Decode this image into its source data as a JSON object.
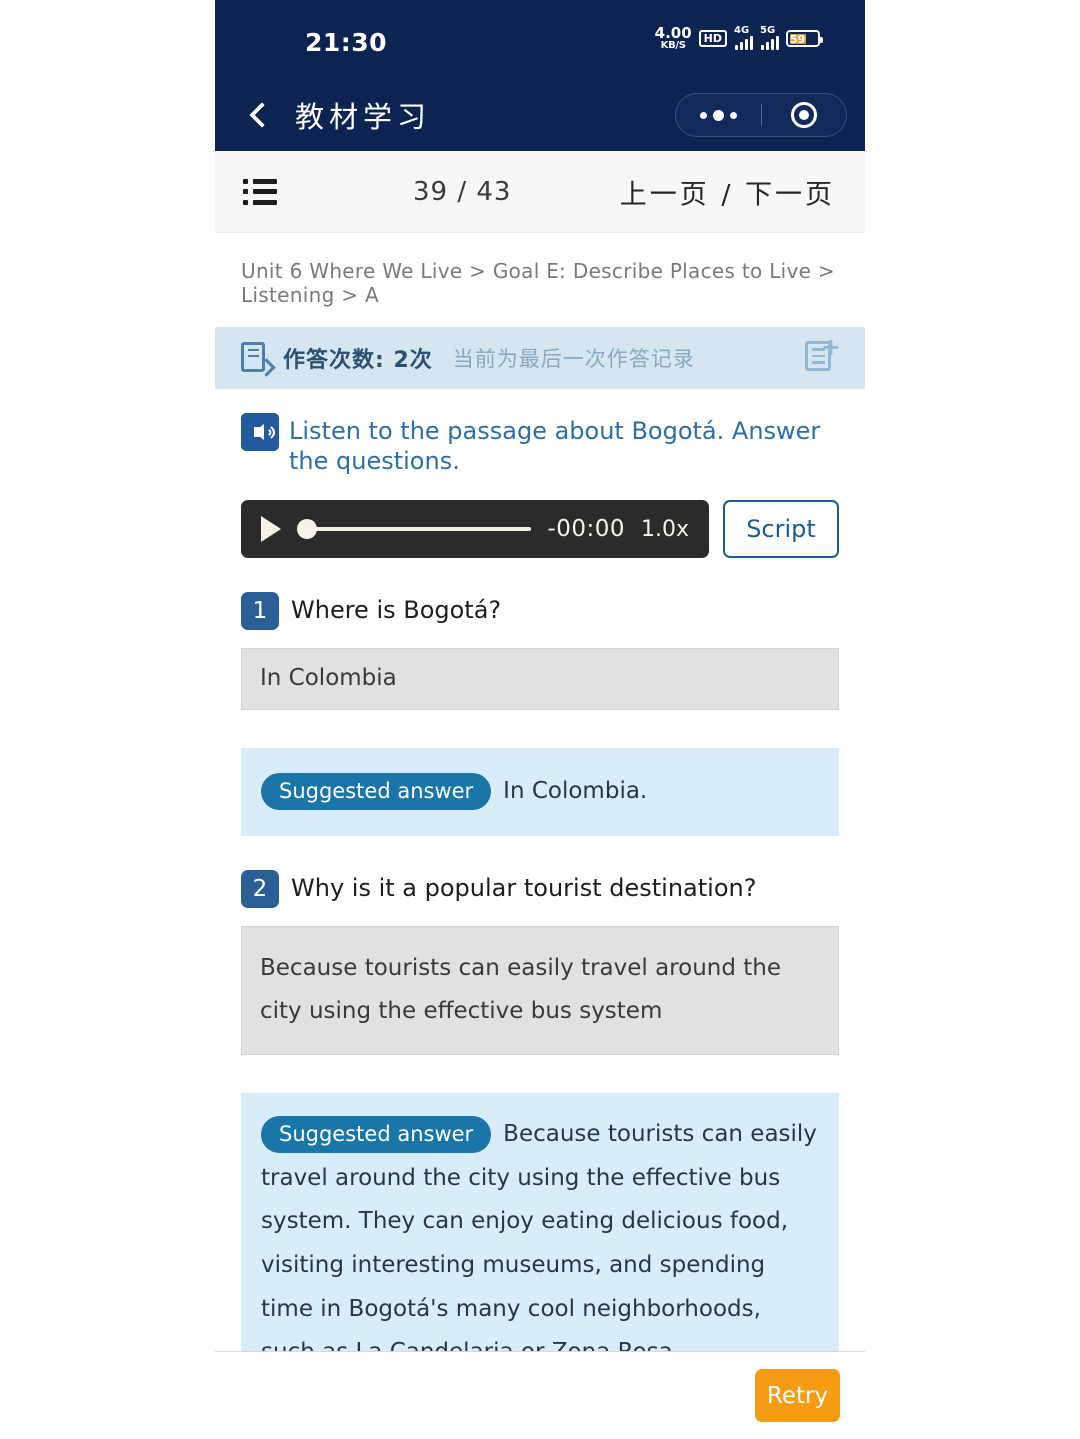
{
  "status_bar": {
    "time": "21:30",
    "net_speed_value": "4.00",
    "net_speed_unit": "KB/S",
    "hd_label": "HD",
    "signal_1_label": "4G",
    "signal_2_label": "5G",
    "battery_level": "59"
  },
  "header": {
    "title": "教材学习",
    "back_icon": "chevron-left-icon",
    "more_icon": "more-dots-icon",
    "close_icon": "target-circle-icon",
    "bg_color": "#0d2352"
  },
  "toolbar": {
    "list_icon": "list-menu-icon",
    "page_counter": "39 / 43",
    "page_nav": "上一页 / 下一页"
  },
  "breadcrumb": {
    "text": "Unit 6 Where We Live > Goal E: Describe Places to Live > Listening > A"
  },
  "attempt_bar": {
    "icon": "edit-document-icon",
    "count_label": "作答次数: 2次",
    "note": "当前为最后一次作答记录",
    "add_icon": "add-document-icon",
    "bg_color": "#d5e6f0"
  },
  "instruction": {
    "icon": "speaker-icon",
    "text": "Listen to the passage about Bogotá. Answer the questions."
  },
  "player": {
    "play_icon": "play-icon",
    "time_remaining": "-00:00",
    "playback_rate": "1.0x",
    "script_label": "Script",
    "progress_percent": 0
  },
  "questions": [
    {
      "number": "1",
      "prompt": "Where is Bogotá?",
      "user_answer": "In Colombia",
      "suggested_badge": "Suggested answer",
      "suggested_answer": "In Colombia."
    },
    {
      "number": "2",
      "prompt": "Why is it a popular tourist destination?",
      "user_answer": "Because tourists can easily travel around the city using the effective bus system",
      "suggested_badge": "Suggested answer",
      "suggested_answer": "Because tourists can easily travel around the city using the effective bus system. They can enjoy eating delicious food, visiting interesting museums, and spending time in Bogotá's many cool neighborhoods, such as La Candelaria or Zona Rosa."
    }
  ],
  "footer": {
    "retry_label": "Retry",
    "retry_color": "#f59c12"
  }
}
